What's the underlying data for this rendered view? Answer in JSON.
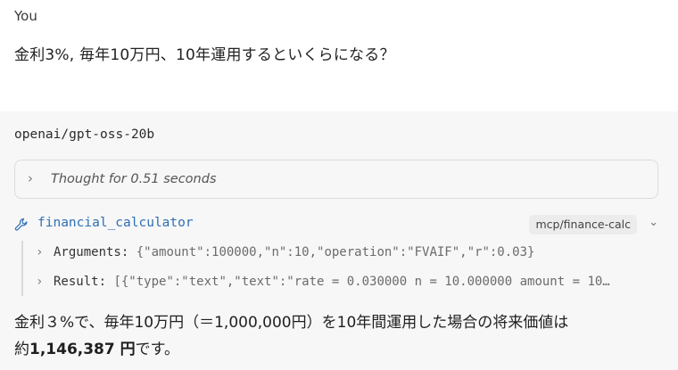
{
  "user": {
    "name": "You",
    "message": "金利3%, 毎年10万円、10年運用するといくらになる？"
  },
  "assistant": {
    "model": "openai/gpt-oss-20b",
    "thought": {
      "label": "Thought for 0.51 seconds"
    },
    "tool": {
      "icon": "wrench-icon",
      "name": "financial_calculator",
      "badge": "mcp/finance-calc",
      "arguments_label": "Arguments:",
      "arguments_value": " {\"amount\":100000,\"n\":10,\"operation\":\"FVAIF\",\"r\":0.03}",
      "result_label": "Result:",
      "result_value": "  [{\"type\":\"text\",\"text\":\"rate = 0.030000 n = 10.000000 amount = 10…"
    },
    "answer": {
      "line1": "金利３%で、毎年10万円（＝1,000,000円）を10年間運用した場合の将来価値は",
      "line2_prefix": "約",
      "line2_bold": "1,146,387 円",
      "line2_suffix": "です。"
    }
  },
  "colors": {
    "tool_name": "#2f6fb5",
    "assistant_bg": "#f7f7f7"
  }
}
